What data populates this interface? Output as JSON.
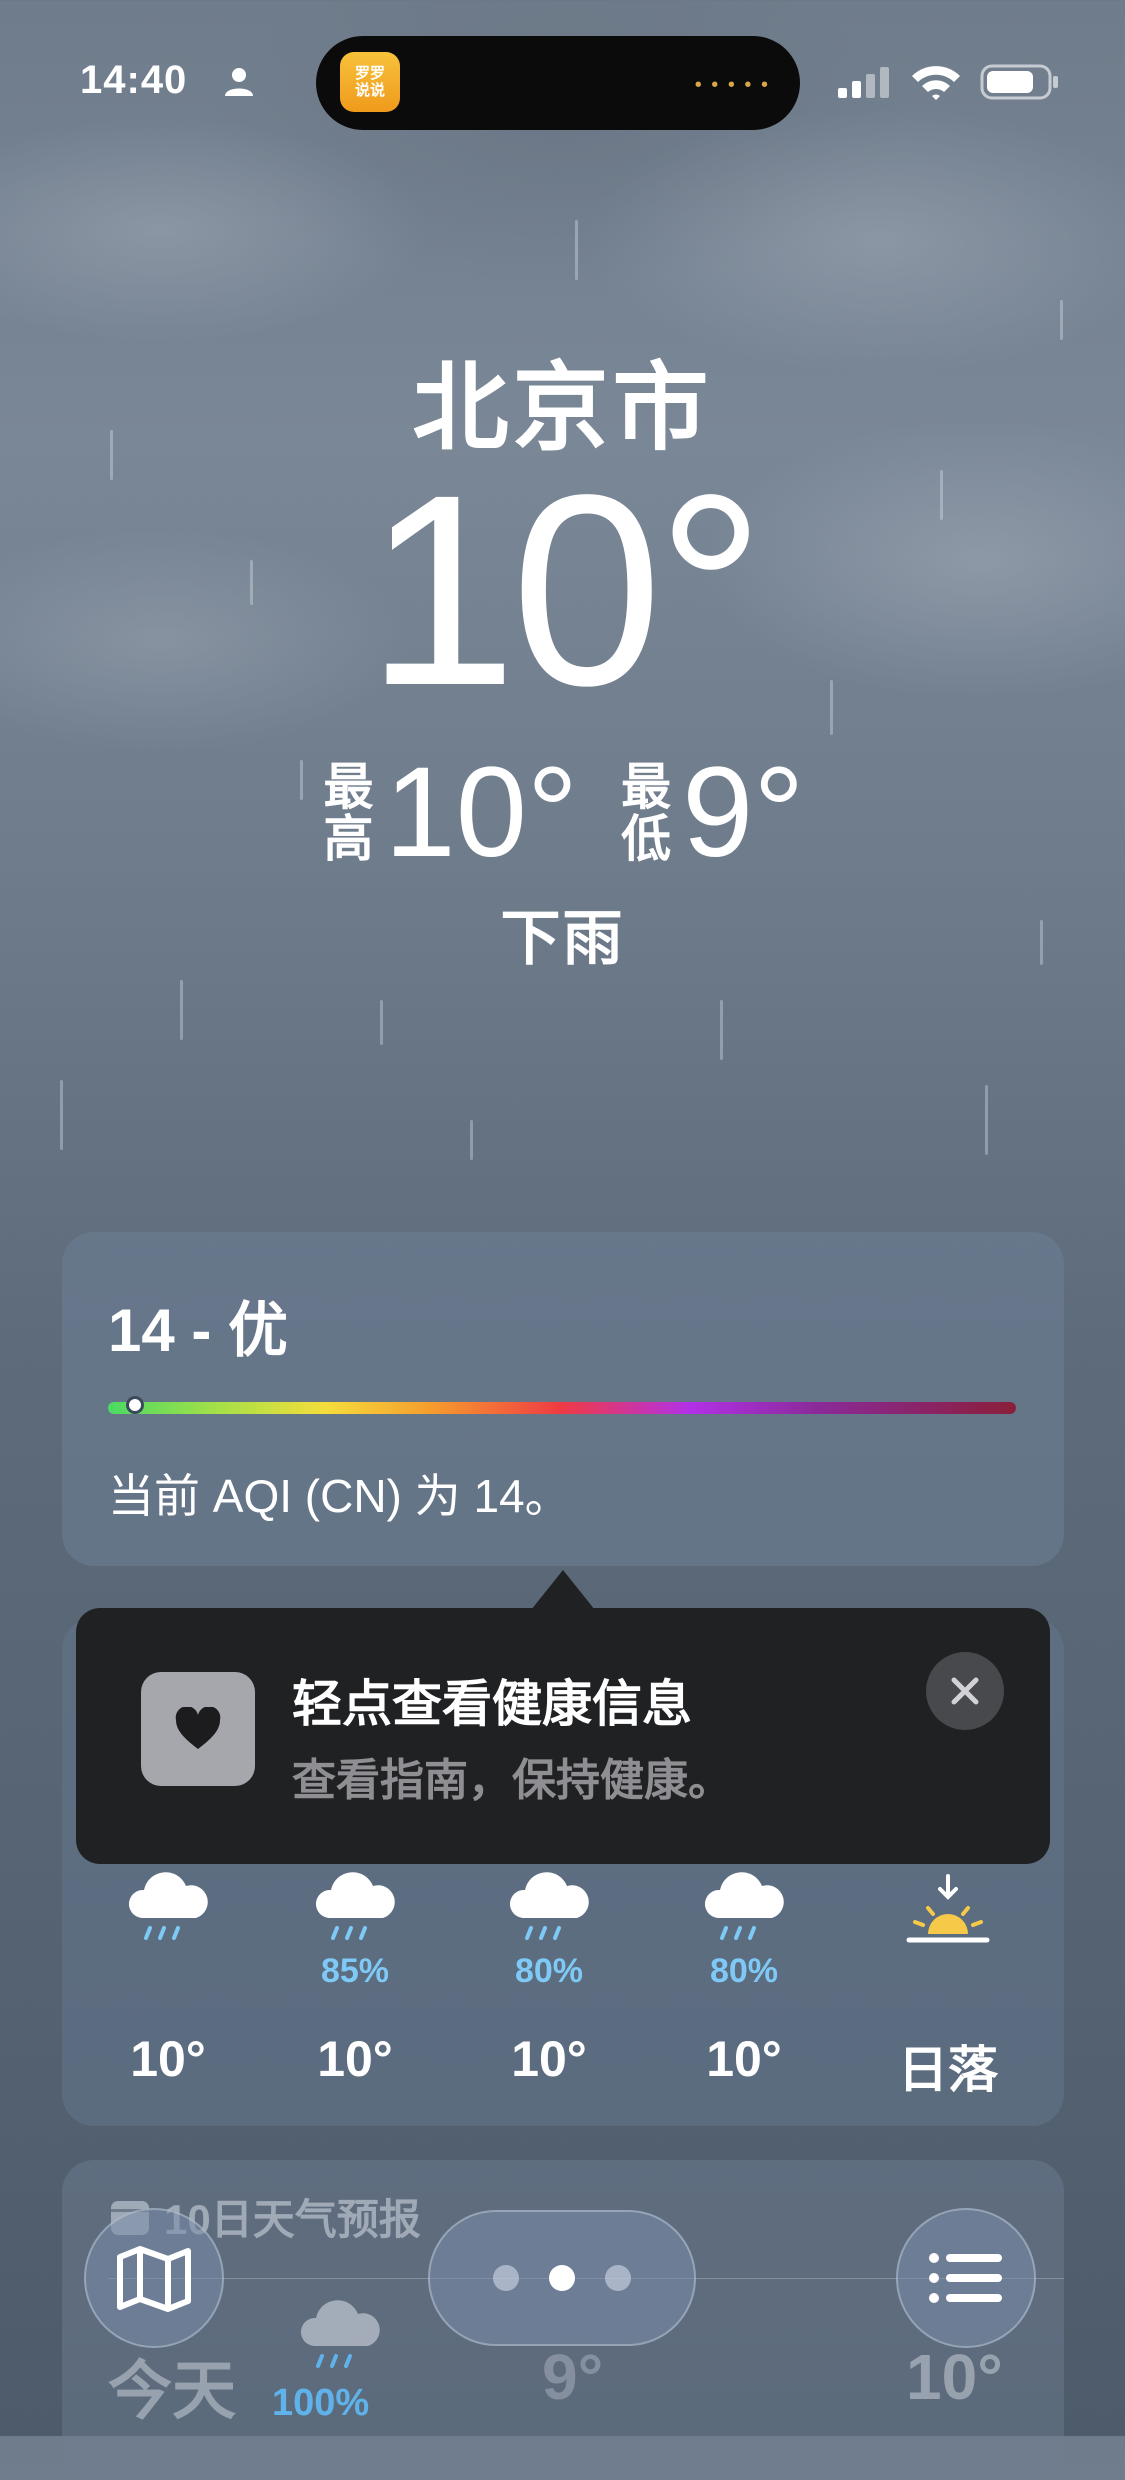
{
  "status_bar": {
    "time": "14:40",
    "island_app_line1": "罗罗",
    "island_app_line2": "说说"
  },
  "current": {
    "city": "北京市",
    "temperature": "10°",
    "high_label": "最高",
    "high_value": "10°",
    "low_label": "最低",
    "low_value": "9°",
    "condition": "下雨"
  },
  "aqi": {
    "value_text": "14 - 优",
    "description": "当前 AQI (CN) 为 14。",
    "index_fraction": 0.03
  },
  "health_tip": {
    "title": "轻点查看健康信息",
    "subtitle": "查看指南，保持健康。",
    "icon": "heart-icon"
  },
  "hourly": [
    {
      "icon": "rain-cloud-icon",
      "pct": "",
      "temp": "10°"
    },
    {
      "icon": "rain-cloud-icon",
      "pct": "85%",
      "temp": "10°"
    },
    {
      "icon": "rain-cloud-icon",
      "pct": "80%",
      "temp": "10°"
    },
    {
      "icon": "rain-cloud-icon",
      "pct": "80%",
      "temp": "10°"
    },
    {
      "icon": "sunset-icon",
      "pct": "",
      "temp": "日落"
    }
  ],
  "ten_day": {
    "header": "10日天气预报",
    "day": "今天",
    "pct": "100%",
    "low": "9°",
    "high": "10°"
  },
  "colors": {
    "precip_blue": "#7ec9f5",
    "sunset_yellow": "#f7c948",
    "tooltip_bg": "#202123"
  }
}
